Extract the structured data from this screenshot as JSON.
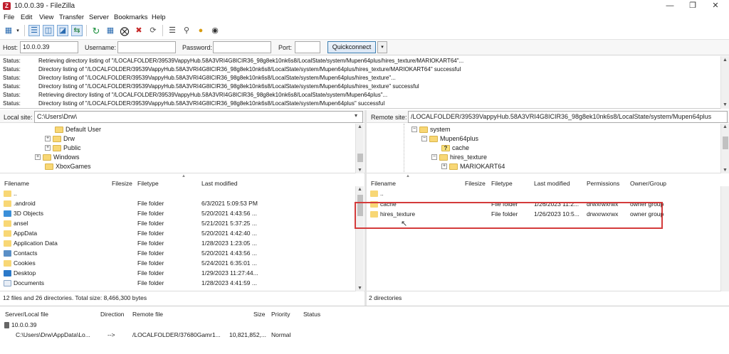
{
  "window": {
    "title": "10.0.0.39 - FileZilla",
    "app_icon_letter": "Z",
    "minimize": "—",
    "maximize": "❐",
    "close": "✕"
  },
  "menu": [
    "File",
    "Edit",
    "View",
    "Transfer",
    "Server",
    "Bookmarks",
    "Help"
  ],
  "quickconnect": {
    "host_label": "Host:",
    "host_value": "10.0.0.39",
    "username_label": "Username:",
    "username_value": "",
    "password_label": "Password:",
    "password_value": "",
    "port_label": "Port:",
    "port_value": "",
    "button": "Quickconnect",
    "dropdown": "▾"
  },
  "log": [
    {
      "k": "Status:",
      "v": "Retrieving directory listing of \"/LOCALFOLDER/39539VappyHub.58A3VRI4G8ICIR36_98g8ek10nk6s8/LocalState/system/Mupen64plus/hires_texture/MARIOKART64\"..."
    },
    {
      "k": "Status:",
      "v": "Directory listing of \"/LOCALFOLDER/39539VappyHub.58A3VRI4G8ICIR36_98g8ek10nk6s8/LocalState/system/Mupen64plus/hires_texture/MARIOKART64\" successful"
    },
    {
      "k": "Status:",
      "v": "Directory listing of \"/LOCALFOLDER/39539VappyHub.58A3VRI4G8ICIR36_98g8ek10nk6s8/LocalState/system/Mupen64plus/hires_texture\"..."
    },
    {
      "k": "Status:",
      "v": "Directory listing of \"/LOCALFOLDER/39539VappyHub.58A3VRI4G8ICIR36_98g8ek10nk6s8/LocalState/system/Mupen64plus/hires_texture\" successful"
    },
    {
      "k": "Status:",
      "v": "Retrieving directory listing of \"/LOCALFOLDER/39539VappyHub.58A3VRI4G8ICIR36_98g8ek10nk6s8/LocalState/system/Mupen64plus\"..."
    },
    {
      "k": "Status:",
      "v": "Directory listing of \"/LOCALFOLDER/39539VappyHub.58A3VRI4G8ICIR36_98g8ek10nk6s8/LocalState/system/Mupen64plus\" successful"
    }
  ],
  "local": {
    "site_label": "Local site:",
    "site_path": "C:\\Users\\Drw\\",
    "tree": [
      {
        "label": "Default User",
        "expander": ""
      },
      {
        "label": "Drw",
        "expander": "+"
      },
      {
        "label": "Public",
        "expander": "+"
      },
      {
        "label": "Windows",
        "expander": "+"
      },
      {
        "label": "XboxGames",
        "expander": ""
      }
    ],
    "headers": {
      "filename": "Filename",
      "filesize": "Filesize",
      "filetype": "Filetype",
      "modified": "Last modified"
    },
    "files": [
      {
        "name": "..",
        "type": "",
        "modified": "",
        "icon": "folder"
      },
      {
        "name": ".android",
        "type": "File folder",
        "modified": "6/3/2021 5:09:53 PM",
        "icon": "folder"
      },
      {
        "name": "3D Objects",
        "type": "File folder",
        "modified": "5/20/2021 4:43:56 ...",
        "icon": "3d-objects"
      },
      {
        "name": "ansel",
        "type": "File folder",
        "modified": "5/21/2021 5:37:25 ...",
        "icon": "folder"
      },
      {
        "name": "AppData",
        "type": "File folder",
        "modified": "5/20/2021 4:42:40 ...",
        "icon": "folder"
      },
      {
        "name": "Application Data",
        "type": "File folder",
        "modified": "1/28/2023 1:23:05 ...",
        "icon": "folder"
      },
      {
        "name": "Contacts",
        "type": "File folder",
        "modified": "5/20/2021 4:43:56 ...",
        "icon": "contacts"
      },
      {
        "name": "Cookies",
        "type": "File folder",
        "modified": "5/24/2021 6:35:01 ...",
        "icon": "folder"
      },
      {
        "name": "Desktop",
        "type": "File folder",
        "modified": "1/29/2023 11:27:44...",
        "icon": "desktop"
      },
      {
        "name": "Documents",
        "type": "File folder",
        "modified": "1/28/2023 4:41:59 ...",
        "icon": "documents"
      }
    ],
    "status": "12 files and 26 directories. Total size: 8,466,300 bytes"
  },
  "remote": {
    "site_label": "Remote site:",
    "site_path": "/LOCALFOLDER/39539VappyHub.58A3VRI4G8ICIR36_98g8ek10nk6s8/LocalState/system/Mupen64plus",
    "tree": [
      {
        "label": "system",
        "expander": "−",
        "icon": "folder"
      },
      {
        "label": "Mupen64plus",
        "expander": "−",
        "icon": "folder"
      },
      {
        "label": "cache",
        "expander": "",
        "icon": "unknown"
      },
      {
        "label": "hires_texture",
        "expander": "−",
        "icon": "folder"
      },
      {
        "label": "MARIOKART64",
        "expander": "+",
        "icon": "folder"
      }
    ],
    "headers": {
      "filename": "Filename",
      "filesize": "Filesize",
      "filetype": "Filetype",
      "modified": "Last modified",
      "permissions": "Permissions",
      "owner": "Owner/Group"
    },
    "files": [
      {
        "name": "..",
        "type": "",
        "modified": "",
        "perms": "",
        "owner": ""
      },
      {
        "name": "cache",
        "type": "File folder",
        "modified": "1/26/2023 11:2...",
        "perms": "drwxrwxrwx",
        "owner": "owner group"
      },
      {
        "name": "hires_texture",
        "type": "File folder",
        "modified": "1/26/2023 10:5...",
        "perms": "drwxrwxrwx",
        "owner": "owner group"
      }
    ],
    "status": "2 directories"
  },
  "queue": {
    "headers": {
      "server": "Server/Local file",
      "direction": "Direction",
      "remote": "Remote file",
      "size": "Size",
      "priority": "Priority",
      "status": "Status"
    },
    "server": "10.0.0.39",
    "item": {
      "local": "C:\\Users\\Drw\\AppData\\Lo...",
      "direction": "-->",
      "remote": "/LOCALFOLDER/37680Gamr1...",
      "size": "10,821,852,...",
      "priority": "Normal"
    }
  },
  "colors": {
    "folder": "#f8d775",
    "highlight_box": "#d43b3b",
    "quickconnect_border": "#3c7fb1"
  }
}
